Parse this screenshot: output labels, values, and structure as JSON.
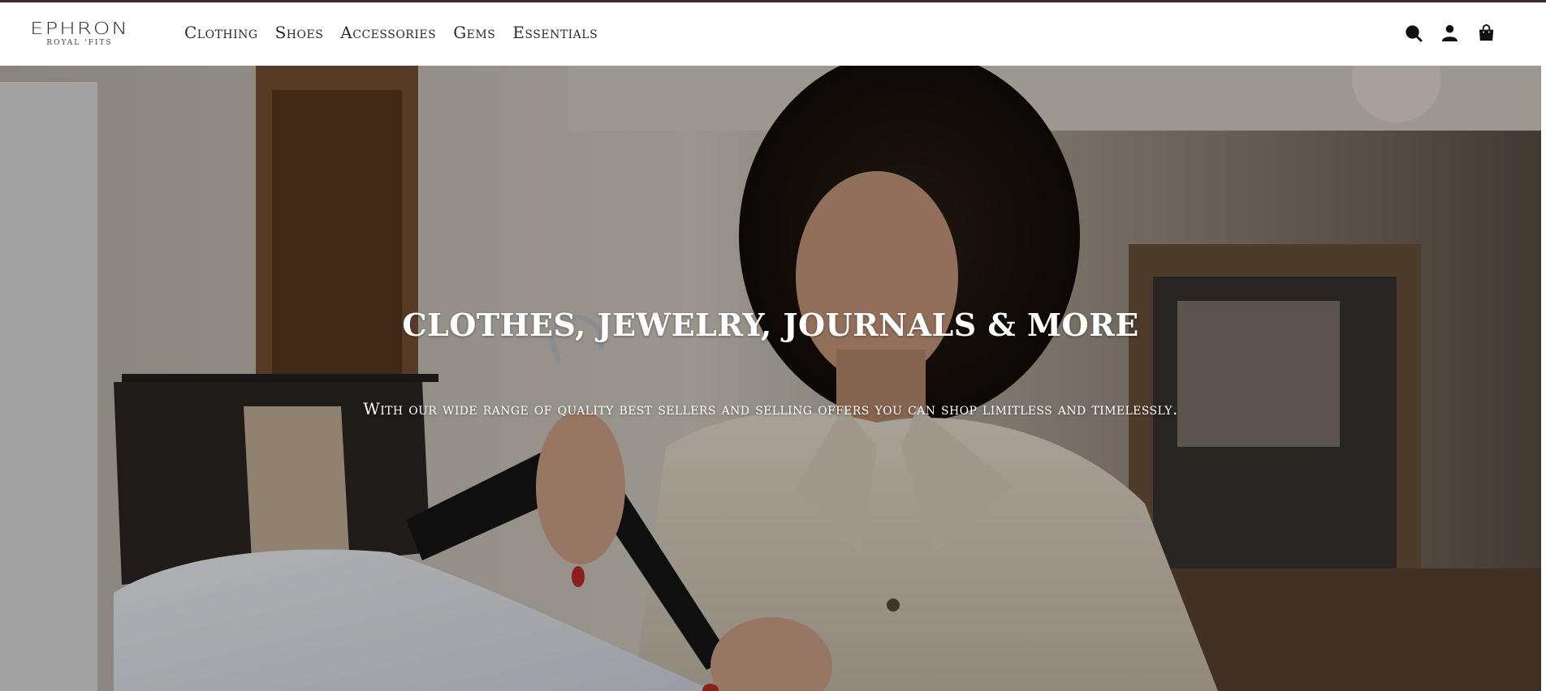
{
  "brand": {
    "name": "EPHRON",
    "tagline": "ROYAL 'FITS"
  },
  "nav": {
    "items": [
      {
        "label": "Clothing"
      },
      {
        "label": "Shoes"
      },
      {
        "label": "Accessories"
      },
      {
        "label": "Gems"
      },
      {
        "label": "Essentials"
      }
    ]
  },
  "header_icons": [
    "search-icon",
    "account-icon",
    "cart-bag-icon"
  ],
  "hero": {
    "title": "CLOTHES, JEWELRY, JOURNALS & MORE",
    "subtitle": "With our wide range of quality best sellers and selling offers you can shop limitless and timelessly."
  },
  "colors": {
    "accent_topline": "#3b2a2a",
    "text_dark": "#2a2a2a",
    "hero_text": "#ffffff"
  }
}
